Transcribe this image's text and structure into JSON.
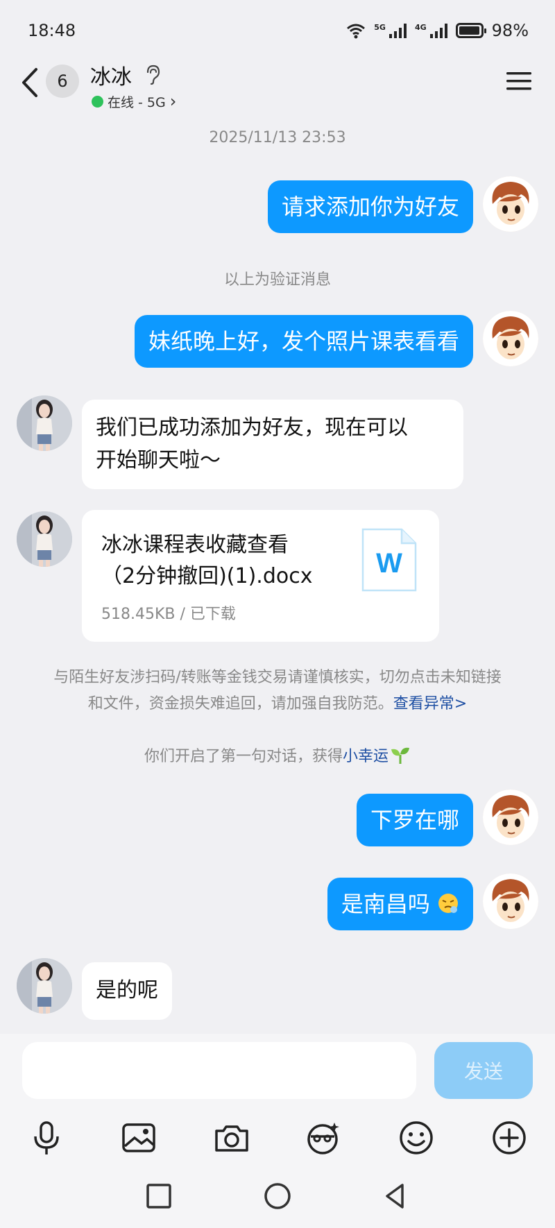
{
  "status_bar": {
    "time": "18:48",
    "net1": "5G",
    "net2": "4G",
    "battery": "98%",
    "battery_level": 0.98
  },
  "header": {
    "unread_count": "6",
    "contact_name": "冰冰",
    "status_text": "在线 - 5G",
    "status_chevron": "›",
    "online_color": "#2ec25b"
  },
  "chat": {
    "timestamp": "2025/11/13 23:53",
    "messages": [
      {
        "from": "me",
        "text": "请求添加你为好友"
      },
      {
        "from": "system",
        "text": "以上为验证消息"
      },
      {
        "from": "me",
        "text": "妹纸晚上好，发个照片课表看看"
      },
      {
        "from": "her",
        "text_line1": "我们已成功添加为好友，现在可以",
        "text_line2": "开始聊天啦～"
      },
      {
        "from": "her",
        "type": "file",
        "file_name_line1": "冰冰课程表收藏查看",
        "file_name_line2": "（2分钟撤回)(1).docx",
        "file_meta": "518.45KB / 已下载",
        "file_icon_letter": "W"
      },
      {
        "from": "system",
        "warn_line1": "与陌生好友涉扫码/转账等金钱交易请谨慎核实，切勿点击未知链接",
        "warn_line2": "和文件，资金损失难追回，请加强自我防范。",
        "warn_link": "查看异常>"
      },
      {
        "from": "system",
        "lucky_text": "你们开启了第一句对话，获得",
        "lucky_link": "小幸运"
      },
      {
        "from": "me",
        "text": "下罗在哪"
      },
      {
        "from": "me",
        "text": "是南昌吗"
      },
      {
        "from": "her",
        "text": "是的呢"
      }
    ]
  },
  "input_bar": {
    "placeholder": "",
    "send_label": "发送"
  },
  "colors": {
    "accent": "#0d99ff",
    "link": "#1e4fa3",
    "background": "#f0f0f3"
  },
  "icons": [
    "back-icon",
    "ear-icon",
    "menu-icon",
    "mic-icon",
    "image-icon",
    "camera-icon",
    "sticker-icon",
    "emoji-icon",
    "plus-icon"
  ]
}
